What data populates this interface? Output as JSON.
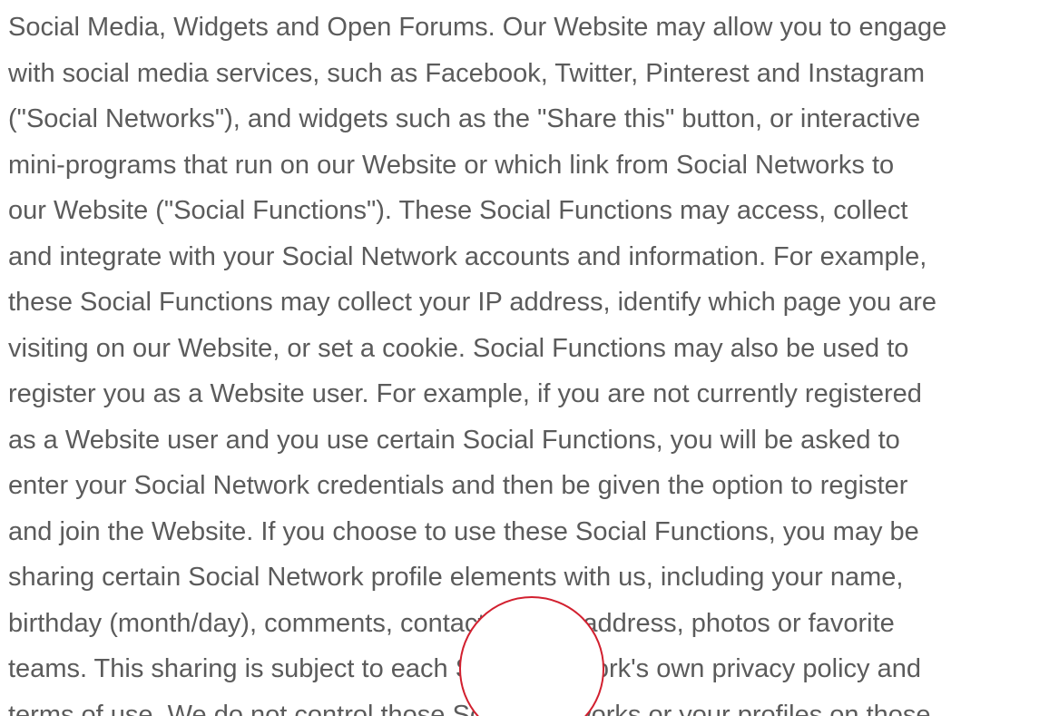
{
  "paragraph": {
    "lines": [
      "Social Media, Widgets and Open Forums. Our Website may allow you to engage",
      "with social media services, such as Facebook, Twitter, Pinterest and Instagram",
      "(\"Social Networks\"), and widgets such as the \"Share this\" button, or interactive",
      "mini-programs that run on our Website or which link from Social Networks to",
      "our Website (\"Social Functions\"). These Social Functions may access, collect",
      "and integrate with your Social Network accounts and information. For example,",
      "these Social Functions may collect your IP address, identify which page you are",
      "visiting on our Website, or set a cookie. Social Functions may also be used to",
      "register you as a Website user. For example, if you are not currently registered",
      "as a Website user and you use certain Social Functions, you will be asked to",
      "enter your Social Network credentials and then be given the option to register",
      "and join the Website. If you choose to use these Social Functions, you may be",
      "sharing certain Social Network profile elements with us, including your name,",
      "birthday (month/day), comments, contacts, email address, photos or favorite",
      "teams. This sharing is subject to each Social Network's own privacy policy and",
      "terms of use. We do not control those Social Networks or your profiles on those"
    ]
  },
  "overlay": {
    "border_color": "#d2202f",
    "fill_color": "#ffffff"
  },
  "colors": {
    "text": "#5b5b5b",
    "background": "#ffffff"
  }
}
